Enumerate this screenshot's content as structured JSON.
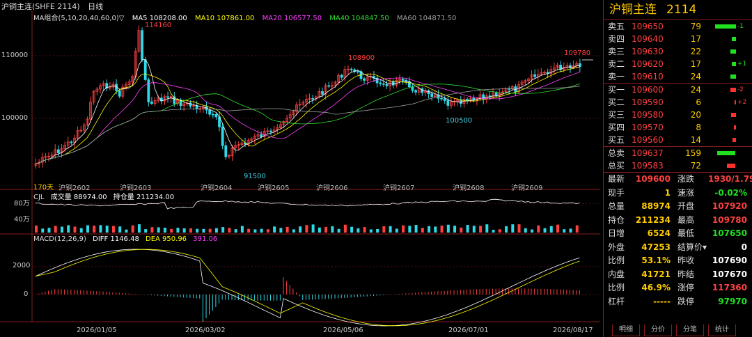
{
  "header": {
    "symbol": "沪铜主连(SHFE 2114)",
    "period": "日线",
    "ma_group": "MA组合(5,10,20,40,60,0)",
    "ma_group_arrow": "▽",
    "ma5": "MA5 108208.00",
    "ma10": "MA10 107861.00",
    "ma20": "MA20 106577.50",
    "ma40": "MA40 104847.50",
    "ma60": "MA60 104871.50",
    "color_ma5": "#ffffff",
    "color_ma10": "#ffff00",
    "color_ma20": "#ff40ff",
    "color_ma40": "#30e030",
    "color_ma60": "#a0a0a0"
  },
  "price_axis": {
    "labels": [
      "110000",
      "100000"
    ]
  },
  "price_annotations": {
    "high1": "114160",
    "high2": "108900",
    "high3": "109780",
    "low1": "91500",
    "low2": "100500"
  },
  "contract_labels": [
    "沪铜2602",
    "沪铜2603",
    "沪铜2604",
    "沪铜2605",
    "沪铜2606",
    "沪铜2607",
    "沪铜2608",
    "沪铜2609"
  ],
  "days_label": "170天",
  "volume": {
    "name": "CJL",
    "vol_text": "成交量 88974.00",
    "oi_text": "持仓量 211234.00",
    "axis_labels": [
      "80万",
      "40万"
    ]
  },
  "macd": {
    "name": "MACD(12,26,9)",
    "diff": "DIFF 1146.48",
    "dea": "DEA 950.96",
    "macd": "391.06",
    "axis_labels": [
      "2000",
      "0"
    ]
  },
  "date_axis": [
    "2026/01/05",
    "2026/03/02",
    "2026/05/06",
    "2026/07/01",
    "2026/08/17"
  ],
  "side": {
    "title_name": "沪铜主连",
    "title_code": "2114",
    "asks": [
      {
        "k": "卖五",
        "p": "109650",
        "v": "79",
        "chg": "-1"
      },
      {
        "k": "卖四",
        "p": "109640",
        "v": "17",
        "chg": ""
      },
      {
        "k": "卖三",
        "p": "109630",
        "v": "22",
        "chg": ""
      },
      {
        "k": "卖二",
        "p": "109620",
        "v": "17",
        "chg": "+1"
      },
      {
        "k": "卖一",
        "p": "109610",
        "v": "24",
        "chg": ""
      }
    ],
    "bids": [
      {
        "k": "买一",
        "p": "109600",
        "v": "24",
        "chg": "-2"
      },
      {
        "k": "买二",
        "p": "109590",
        "v": "6",
        "chg": "+2"
      },
      {
        "k": "买三",
        "p": "109580",
        "v": "20",
        "chg": ""
      },
      {
        "k": "买四",
        "p": "109570",
        "v": "8",
        "chg": ""
      },
      {
        "k": "买五",
        "p": "109560",
        "v": "14",
        "chg": ""
      }
    ],
    "total_sell": {
      "k": "总卖",
      "p": "109637",
      "v": "159"
    },
    "total_buy": {
      "k": "总买",
      "p": "109583",
      "v": "72"
    },
    "quotes": [
      {
        "k1": "最新",
        "v1": "109600",
        "c1": "red",
        "k2": "涨跌",
        "v2": "1930/1.79%",
        "c2": "red"
      },
      {
        "k1": "现手",
        "v1": "1",
        "c1": "yellow",
        "k2": "速涨",
        "v2": "-0.02%",
        "c2": "green"
      },
      {
        "k1": "总量",
        "v1": "88974",
        "c1": "yellow",
        "k2": "开盘",
        "v2": "107920",
        "c2": "red"
      },
      {
        "k1": "持仓",
        "v1": "211234",
        "c1": "yellow",
        "k2": "最高",
        "v2": "109780",
        "c2": "red"
      },
      {
        "k1": "日增",
        "v1": "6524",
        "c1": "yellow",
        "k2": "最低",
        "v2": "107650",
        "c2": "green"
      },
      {
        "k1": "外盘",
        "v1": "47253",
        "c1": "yellow",
        "k2": "结算价▾",
        "v2": "0",
        "c2": "white"
      },
      {
        "k1": "比例",
        "v1": "53.1%",
        "c1": "yellow",
        "k2": "昨收",
        "v2": "107690",
        "c2": "white"
      },
      {
        "k1": "内盘",
        "v1": "41721",
        "c1": "yellow",
        "k2": "昨结",
        "v2": "107670",
        "c2": "white"
      },
      {
        "k1": "比例",
        "v1": "46.9%",
        "c1": "yellow",
        "k2": "涨停",
        "v2": "117360",
        "c2": "red"
      },
      {
        "k1": "杠杆",
        "v1": "-----",
        "c1": "yellow",
        "k2": "跌停",
        "v2": "97970",
        "c2": "green"
      }
    ],
    "tabs": [
      "明细",
      "分价",
      "分笔",
      "统计"
    ]
  }
}
